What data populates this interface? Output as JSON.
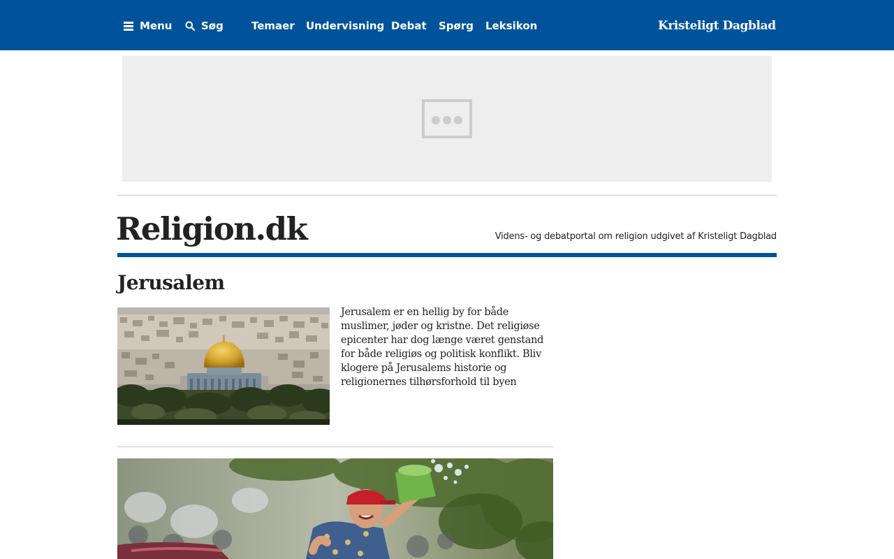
{
  "topnav": {
    "menu_label": "Menu",
    "search_label": "Søg",
    "links": [
      "Temaer",
      "Undervisning",
      "Debat",
      "Spørg",
      "Leksikon"
    ],
    "brand": "Kristeligt Dagblad"
  },
  "site": {
    "logo": "Religion.dk",
    "tagline": "Videns- og debatportal om religion udgivet af Kristeligt Dagblad"
  },
  "section": {
    "title": "Jerusalem",
    "description": "Jerusalem er en hellig by for både muslimer, jøder og kristne. Det religiøse epicenter har dog længe været genstand for både religiøs og politisk konflikt. Bliv klogere på Jerusalems historie og religionernes tilhørsforhold til byen"
  },
  "colors": {
    "brand_blue": "#00539b",
    "ad_background": "#eeeeee",
    "divider": "#cccccc"
  },
  "icons": [
    "menu-icon",
    "search-icon",
    "ad-placeholder-icon"
  ]
}
